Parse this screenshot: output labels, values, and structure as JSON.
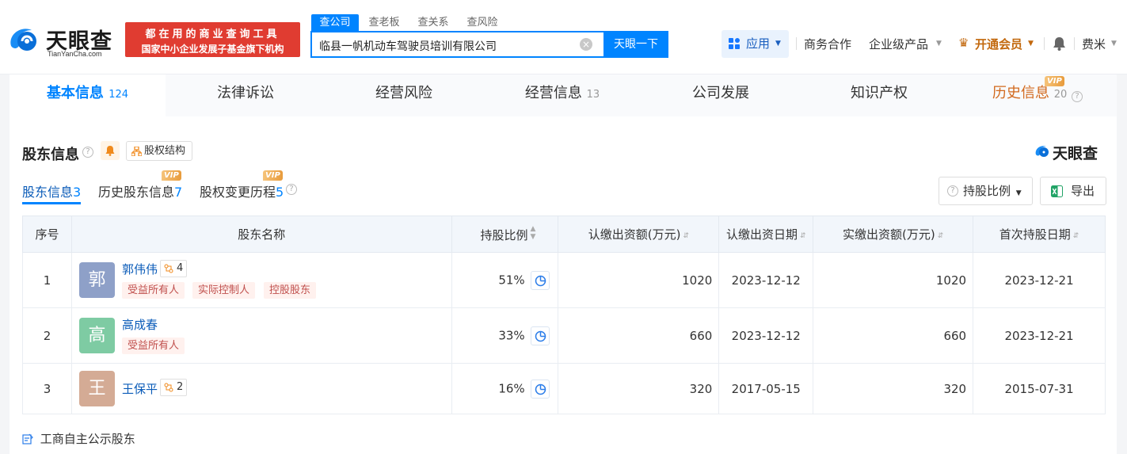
{
  "header": {
    "logo_cn": "天眼查",
    "logo_en": "TianYanCha.com",
    "banner_line1": "都在用的商业查询工具",
    "banner_line2": "国家中小企业发展子基金旗下机构",
    "search_tabs": [
      "查公司",
      "查老板",
      "查关系",
      "查风险"
    ],
    "search_value": "临县一帆机动车驾驶员培训有限公司",
    "search_button": "天眼一下",
    "app_label": "应用",
    "nav_business": "商务合作",
    "nav_enterprise": "企业级产品",
    "nav_vip": "开通会员",
    "user_name": "费米"
  },
  "main_tabs": [
    {
      "label": "基本信息",
      "count": "124"
    },
    {
      "label": "法律诉讼",
      "count": ""
    },
    {
      "label": "经营风险",
      "count": ""
    },
    {
      "label": "经营信息",
      "count": "13"
    },
    {
      "label": "公司发展",
      "count": ""
    },
    {
      "label": "知识产权",
      "count": ""
    },
    {
      "label": "历史信息",
      "count": "20"
    }
  ],
  "vip_badge": "VIP",
  "section": {
    "title": "股东信息",
    "equity_structure": "股权结构",
    "brand": "天眼查",
    "subtabs": [
      {
        "label": "股东信息",
        "count": "3"
      },
      {
        "label": "历史股东信息",
        "count": "7"
      },
      {
        "label": "股权变更历程",
        "count": "5"
      }
    ],
    "holding_ratio_btn": "持股比例",
    "export_btn": "导出",
    "footer_link": "工商自主公示股东"
  },
  "table": {
    "headers": [
      "序号",
      "股东名称",
      "持股比例",
      "认缴出资额(万元)",
      "认缴出资日期",
      "实缴出资额(万元)",
      "首次持股日期"
    ],
    "rows": [
      {
        "no": "1",
        "avatar": "郭",
        "name": "郭伟伟",
        "rel_count": "4",
        "tags": [
          "受益所有人",
          "实际控制人",
          "控股股东"
        ],
        "ratio": "51%",
        "sub_amount": "1020",
        "sub_date": "2023-12-12",
        "paid_amount": "1020",
        "first_date": "2023-12-21"
      },
      {
        "no": "2",
        "avatar": "高",
        "name": "高成春",
        "rel_count": "",
        "tags": [
          "受益所有人"
        ],
        "ratio": "33%",
        "sub_amount": "660",
        "sub_date": "2023-12-12",
        "paid_amount": "660",
        "first_date": "2023-12-21"
      },
      {
        "no": "3",
        "avatar": "王",
        "name": "王保平",
        "rel_count": "2",
        "tags": [],
        "ratio": "16%",
        "sub_amount": "320",
        "sub_date": "2017-05-15",
        "paid_amount": "320",
        "first_date": "2015-07-31"
      }
    ]
  },
  "colors": {
    "accent": "#0084ff",
    "avatar_1": "#8ea0c8",
    "avatar_2": "#7ecba3",
    "avatar_3": "#d4ab95",
    "tag_bg": "#fff1ee",
    "tag_text": "#c0504d"
  }
}
